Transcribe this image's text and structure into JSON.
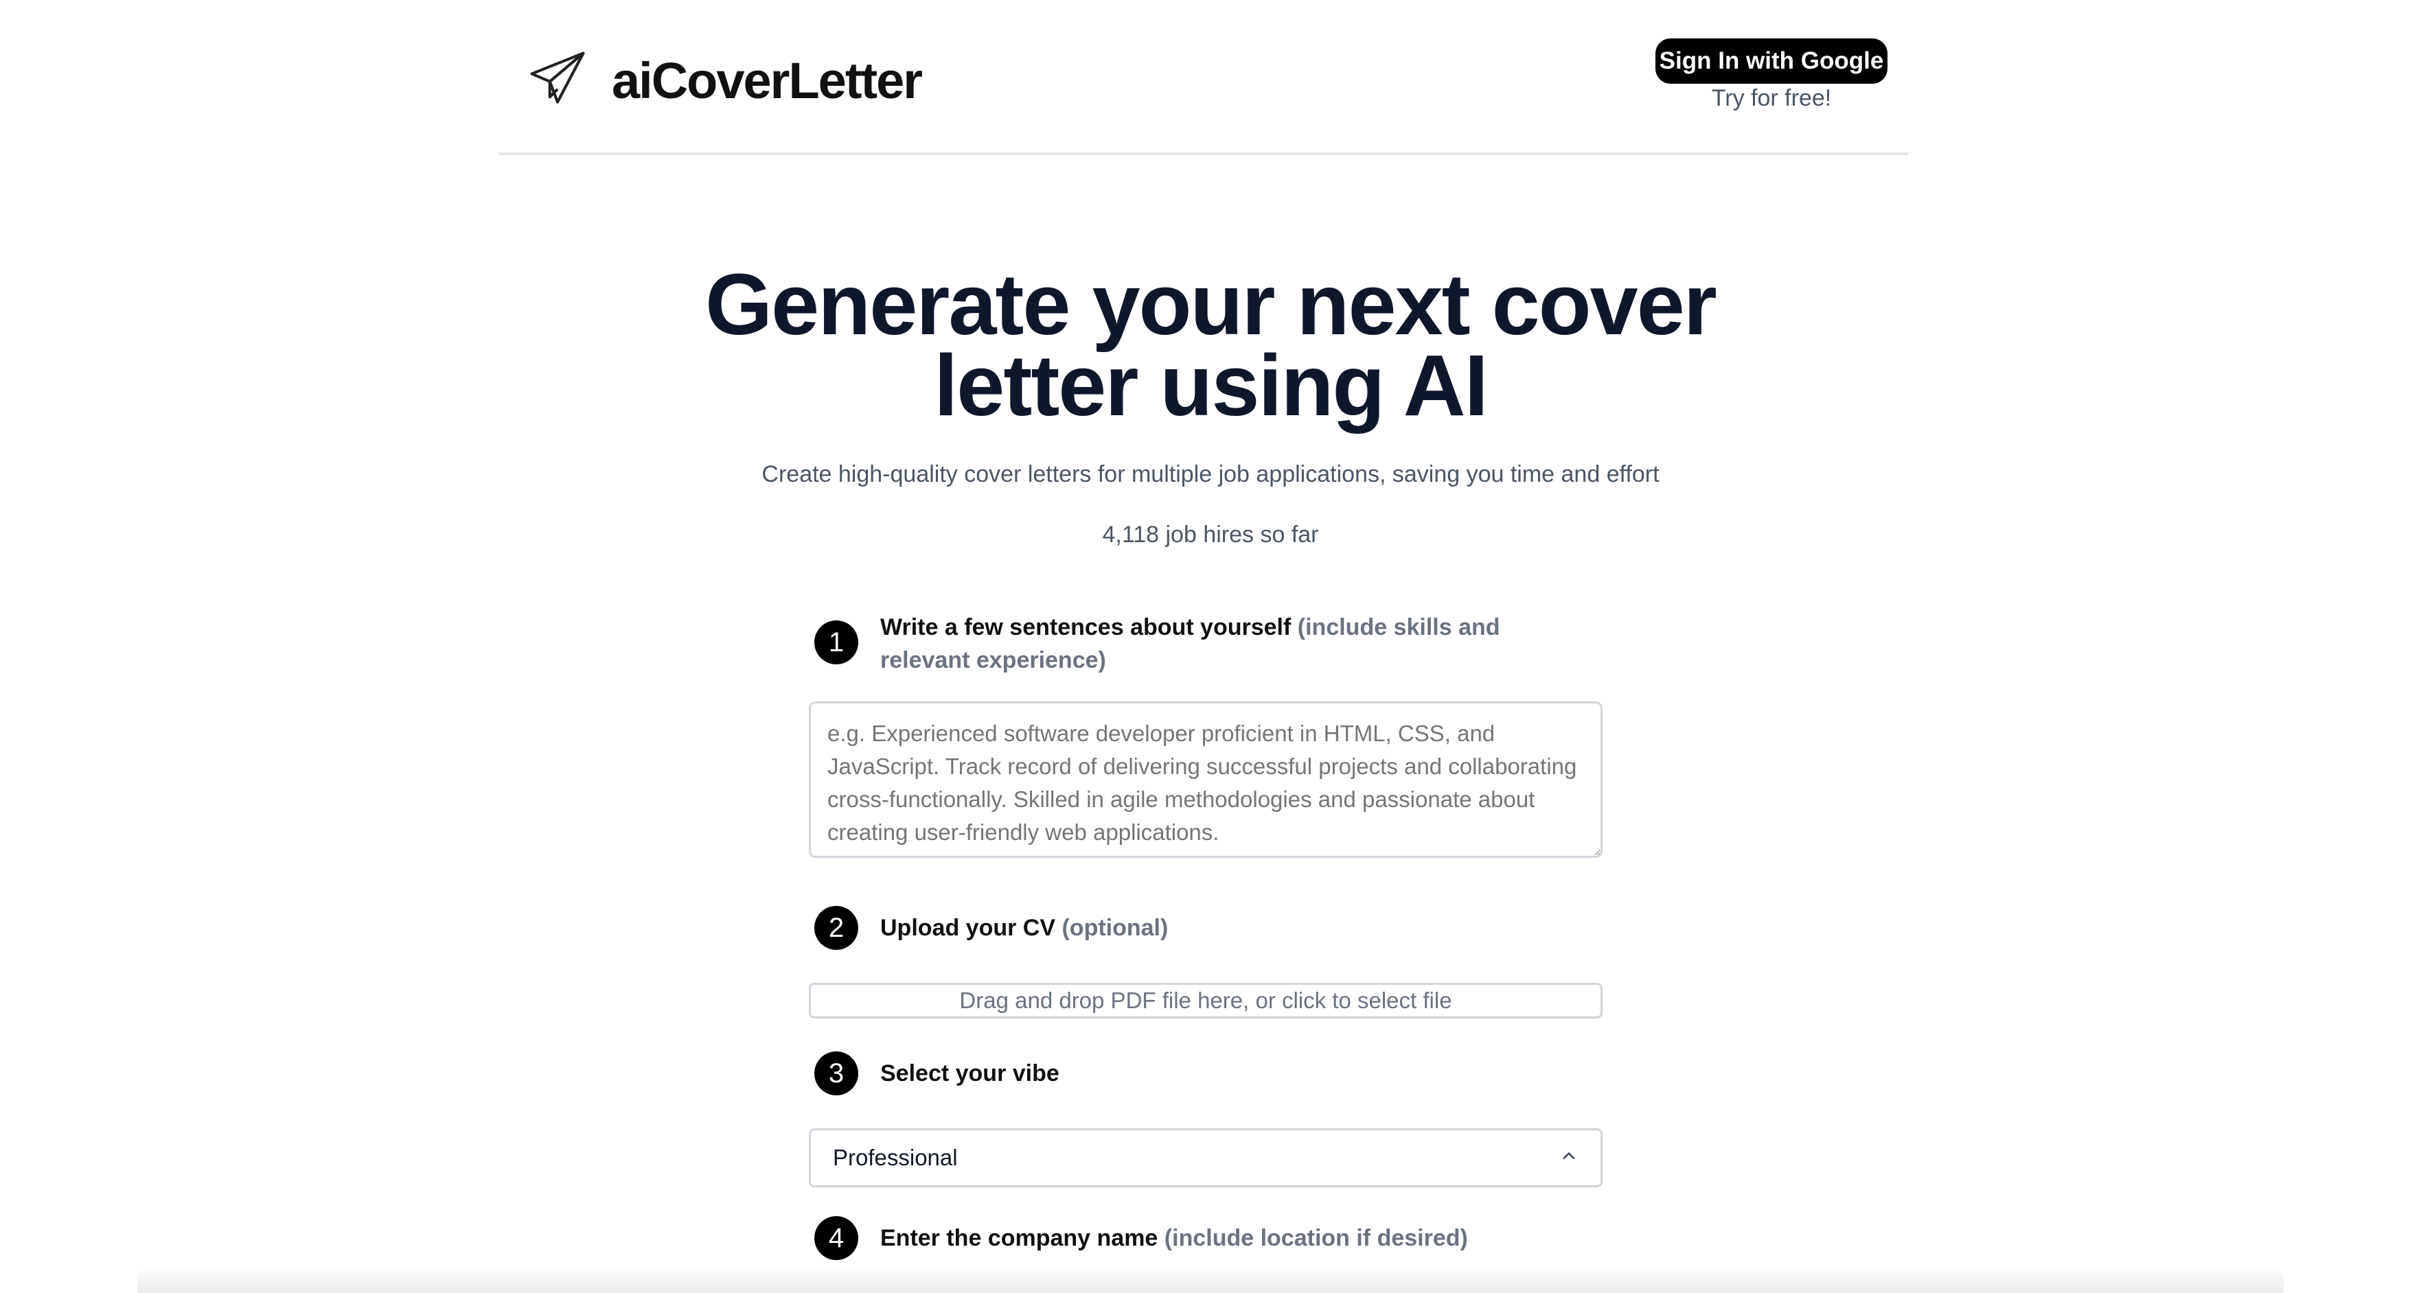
{
  "header": {
    "logo_text": "aiCoverLetter",
    "signin_label": "Sign In with Google",
    "try_label": "Try for free!"
  },
  "hero": {
    "title_line1": "Generate your next cover",
    "title_line2": "letter using AI",
    "subtitle": "Create high-quality cover letters for multiple job applications, saving you time and effort",
    "hires": "4,118 job hires so far"
  },
  "steps": [
    {
      "num": "1",
      "label": "Write a few sentences about yourself",
      "hint": "(include skills and relevant experience)"
    },
    {
      "num": "2",
      "label": "Upload your CV",
      "hint": "(optional)"
    },
    {
      "num": "3",
      "label": "Select your vibe",
      "hint": ""
    },
    {
      "num": "4",
      "label": "Enter the company name",
      "hint": "(include location if desired)"
    }
  ],
  "about": {
    "placeholder": "e.g. Experienced software developer proficient in HTML, CSS, and JavaScript. Track record of delivering successful projects and collaborating cross-functionally. Skilled in agile methodologies and passionate about creating user-friendly web applications."
  },
  "upload": {
    "dropzone_text": "Drag and drop PDF file here, or click to select file"
  },
  "vibe": {
    "selected": "Professional"
  },
  "icons": {
    "logo": "paper-plane-icon",
    "select": "chevron-up-icon"
  }
}
